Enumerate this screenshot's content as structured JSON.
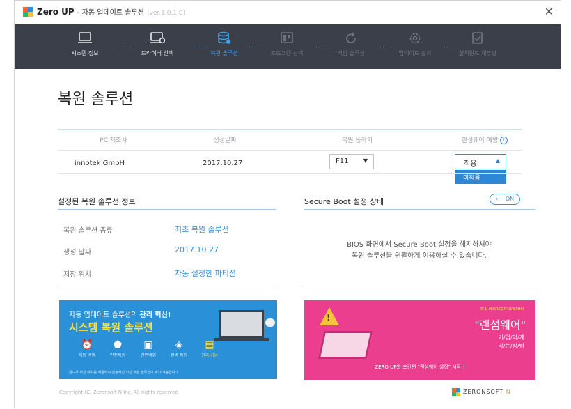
{
  "app": {
    "title": "Zero UP",
    "subtitle": "- 자동 업데이트 솔루션",
    "version": "(ver.1.0.1.0)",
    "close_icon": "close-icon"
  },
  "steps": [
    {
      "label": "시스템 정보",
      "state": "done",
      "icon": "computer-icon"
    },
    {
      "label": "드라이버 선택",
      "state": "done",
      "icon": "computer-icon"
    },
    {
      "label": "복원 솔루션",
      "state": "active",
      "icon": "database-icon"
    },
    {
      "label": "프로그램 선택",
      "state": "todo",
      "icon": "apps-icon"
    },
    {
      "label": "백업 솔루션",
      "state": "todo",
      "icon": "refresh-icon"
    },
    {
      "label": "업데이트 설치",
      "state": "todo",
      "icon": "gear-icon"
    },
    {
      "label": "설치완료 재부팅",
      "state": "todo",
      "icon": "check-doc-icon"
    }
  ],
  "page_title": "복원 솔루션",
  "table": {
    "headers": [
      "PC 제조사",
      "생성날짜",
      "복원 동작키",
      "랜섬웨어 예방"
    ],
    "row": {
      "maker": "innotek GmbH",
      "date": "2017.10.27",
      "key": "F11",
      "ransom_selected": "적용",
      "ransom_option": "미적용"
    }
  },
  "solution_info": {
    "title": "설정된 복원 솔루션 정보",
    "rows": [
      {
        "key": "복원 솔루션 종류",
        "value": "최초 복원 솔루션"
      },
      {
        "key": "생성 날짜",
        "value": "2017.10.27"
      },
      {
        "key": "저장 위치",
        "value": "자동 설정한 파티션"
      }
    ]
  },
  "secure_boot": {
    "title": "Secure Boot 설정 상태",
    "toggle": "ON",
    "line1": "BIOS 화면에서 Secure Boot 설정을 해지하셔야",
    "line2": "복원 솔루션을 원활하게 이용하실 수 있습니다."
  },
  "banner_left": {
    "line1_a": "자동 업데이트 솔루션의",
    "line1_b": "관리 혁신!",
    "line2": "시스템 복원 솔루션",
    "icons": [
      {
        "glyph": "⏰",
        "caption": "자동 백업"
      },
      {
        "glyph": "⬟",
        "caption": "안전복원"
      },
      {
        "glyph": "▣",
        "caption": "간편백업"
      },
      {
        "glyph": "◈",
        "caption": "완벽 복원"
      },
      {
        "glyph": "▤",
        "caption": "관리 기능"
      }
    ],
    "footer": "윈도우 최신 패치를 적용하여 안정적인 최신 복원 솔루션이 추가 가능합니다."
  },
  "banner_right": {
    "tag": "#1 Ransomware!!",
    "title": "\"랜섬웨어\"",
    "sub1": "기/업/의/게",
    "sub2": "막/는/방/법",
    "footer": "ZERO UP의 초간편 \"랜섬웨어 설정\" 시작!!"
  },
  "footer": {
    "copyright": "Copyright (C) Zeronsoft N Inc. All rights reserved",
    "brand": "ZERONSOFT",
    "brand_n": "N"
  },
  "colors": {
    "accent": "#2d86d6",
    "stepbar": "#3a3f4a",
    "banner_blue": "#2a91d8",
    "banner_pink": "#ec3e8e"
  }
}
